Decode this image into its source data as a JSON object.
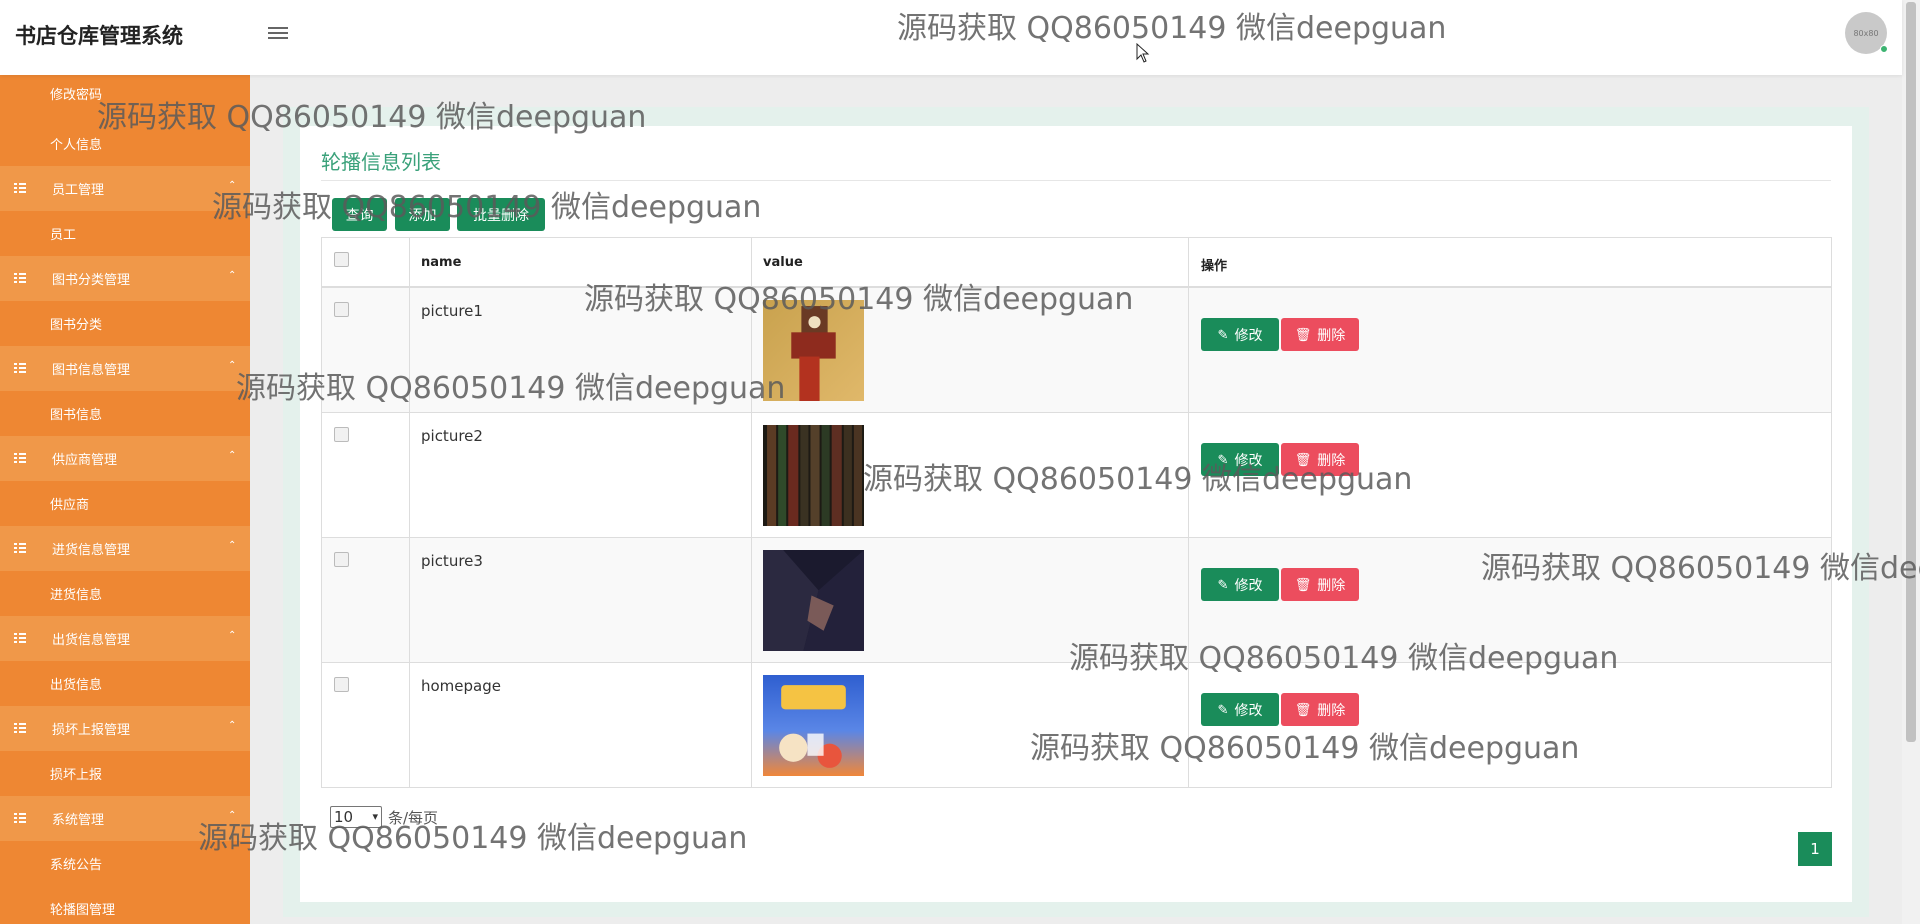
{
  "app_title": "书店仓库管理系统",
  "avatar_text": "80x80",
  "sidebar": {
    "items": [
      {
        "label": "修改密码",
        "type": "sub"
      },
      {
        "label": "个人信息",
        "type": "sub"
      },
      {
        "label": "员工管理",
        "type": "group"
      },
      {
        "label": "员工",
        "type": "sub"
      },
      {
        "label": "图书分类管理",
        "type": "group"
      },
      {
        "label": "图书分类",
        "type": "sub"
      },
      {
        "label": "图书信息管理",
        "type": "group"
      },
      {
        "label": "图书信息",
        "type": "sub"
      },
      {
        "label": "供应商管理",
        "type": "group"
      },
      {
        "label": "供应商",
        "type": "sub"
      },
      {
        "label": "进货信息管理",
        "type": "group"
      },
      {
        "label": "进货信息",
        "type": "sub"
      },
      {
        "label": "出货信息管理",
        "type": "group"
      },
      {
        "label": "出货信息",
        "type": "sub"
      },
      {
        "label": "损坏上报管理",
        "type": "group"
      },
      {
        "label": "损坏上报",
        "type": "sub"
      },
      {
        "label": "系统管理",
        "type": "group"
      },
      {
        "label": "系统公告",
        "type": "sub"
      },
      {
        "label": "轮播图管理",
        "type": "sub"
      }
    ]
  },
  "page_title": "轮播信息列表",
  "toolbar": {
    "query_label": "查询",
    "add_label": "添加",
    "batch_delete_label": "批量删除"
  },
  "table": {
    "columns": [
      "name",
      "value",
      "操作"
    ],
    "rows": [
      {
        "name": "picture1",
        "edit_label": "修改",
        "delete_label": "删除"
      },
      {
        "name": "picture2",
        "edit_label": "修改",
        "delete_label": "删除"
      },
      {
        "name": "picture3",
        "edit_label": "修改",
        "delete_label": "删除"
      },
      {
        "name": "homepage",
        "edit_label": "修改",
        "delete_label": "删除"
      }
    ]
  },
  "pagination": {
    "per_page_value": "10",
    "per_page_suffix": "条/每页",
    "current_page": "1"
  },
  "watermark_text": "源码获取 QQ86050149 微信deepguan",
  "colors": {
    "sidebar": "#ee8733",
    "primary": "#1a8c5a",
    "danger": "#ec4d5e",
    "title": "#3aa17a"
  }
}
